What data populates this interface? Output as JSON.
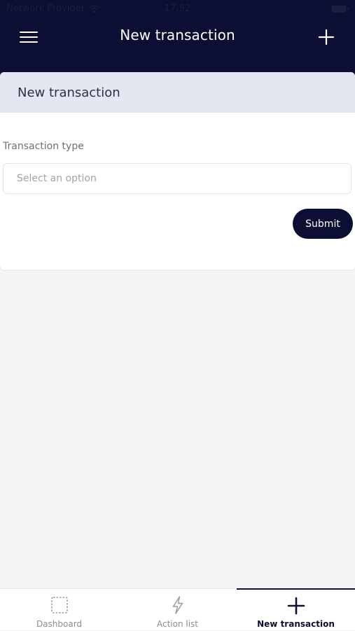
{
  "status_bar": {
    "carrier": "Network Provider",
    "time": "17:52"
  },
  "header": {
    "title": "New transaction"
  },
  "card": {
    "title": "New transaction",
    "field_label": "Transaction type",
    "select_placeholder": "Select an option",
    "submit_label": "Submit"
  },
  "bottom_nav": {
    "items": [
      {
        "label": "Dashboard",
        "icon": "dashboard-icon",
        "active": false
      },
      {
        "label": "Action list",
        "icon": "lightning-icon",
        "active": false
      },
      {
        "label": "New transaction",
        "icon": "plus-icon",
        "active": true
      }
    ]
  },
  "colors": {
    "primary": "#0c0f33",
    "card_header": "#e3e7f2",
    "background": "#f4f4f5"
  }
}
